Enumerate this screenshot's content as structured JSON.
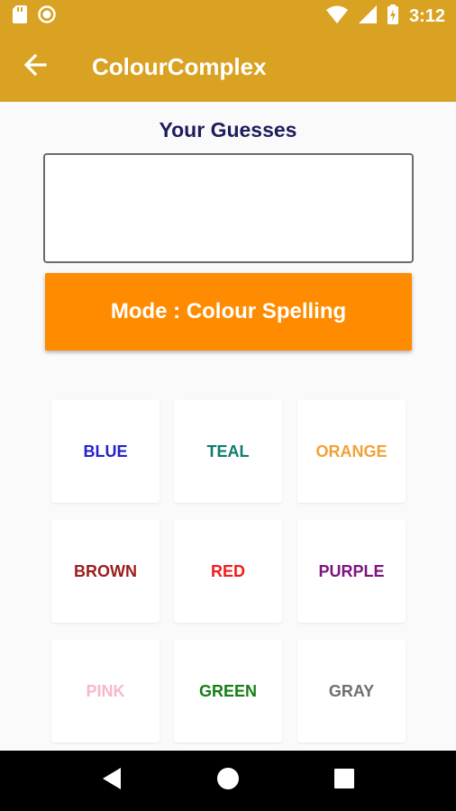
{
  "status_bar": {
    "time": "3:12",
    "left_icons": [
      "sd-card-icon",
      "record-icon"
    ],
    "right_icons": [
      "wifi-icon",
      "signal-icon",
      "battery-charging-icon"
    ]
  },
  "app_bar": {
    "title": "ColourComplex",
    "back_icon": "arrow-left-icon",
    "color": "#d9a222"
  },
  "guesses": {
    "title": "Your Guesses",
    "value": ""
  },
  "mode_button": {
    "label": "Mode : Colour Spelling",
    "color": "#ff8c00"
  },
  "color_tiles": [
    {
      "label": "BLUE",
      "color": "#2323c8"
    },
    {
      "label": "TEAL",
      "color": "#117a72"
    },
    {
      "label": "ORANGE",
      "color": "#f2a134"
    },
    {
      "label": "BROWN",
      "color": "#9b1c1c"
    },
    {
      "label": "RED",
      "color": "#f21b1b"
    },
    {
      "label": "PURPLE",
      "color": "#7e1480"
    },
    {
      "label": "PINK",
      "color": "#f7b8c8"
    },
    {
      "label": "GREEN",
      "color": "#177d17"
    },
    {
      "label": "GRAY",
      "color": "#6e6e6e"
    }
  ],
  "nav_bar": {
    "buttons": [
      "back-triangle-icon",
      "home-circle-icon",
      "recents-square-icon"
    ]
  }
}
